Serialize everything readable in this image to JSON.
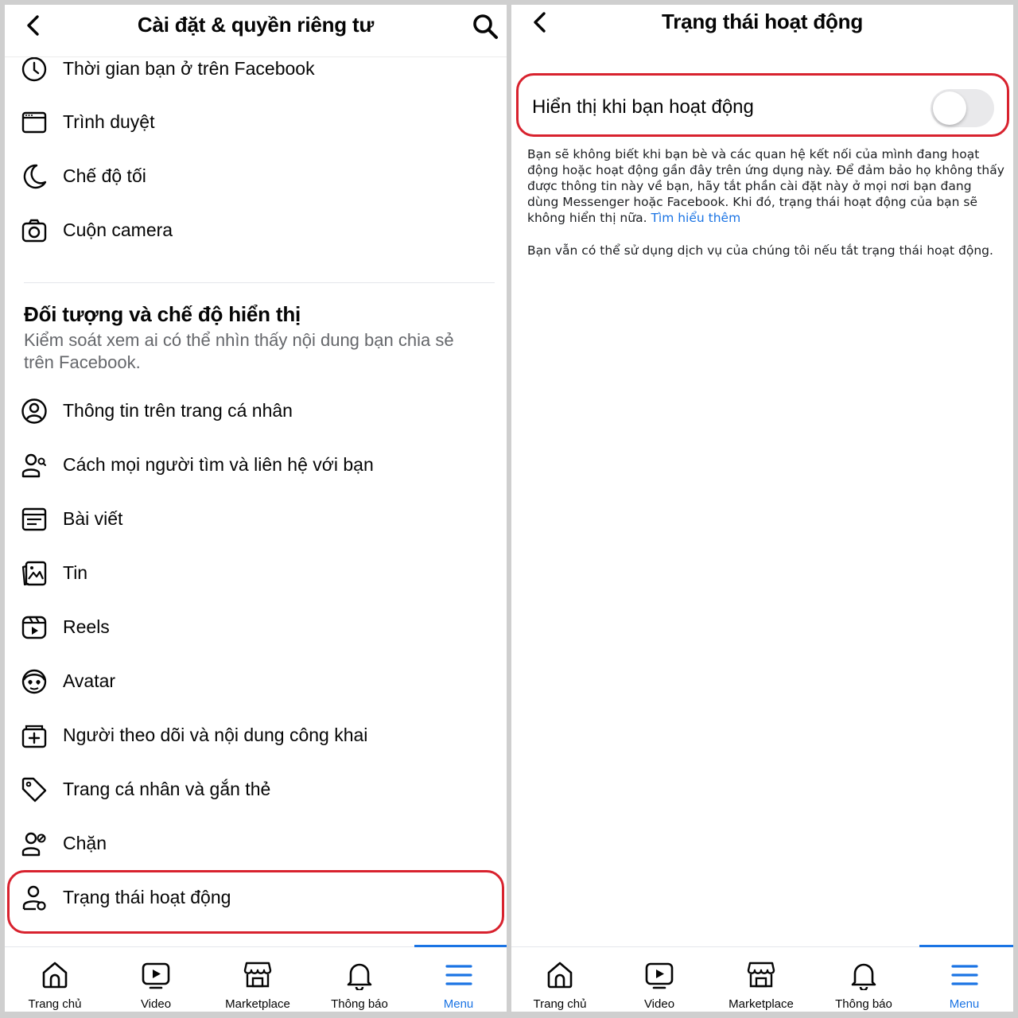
{
  "left": {
    "header_title": "Cài đặt & quyền riêng tư",
    "top_items": [
      {
        "label": "Thời gian bạn ở trên Facebook",
        "icon": "clock-icon"
      },
      {
        "label": "Trình duyệt",
        "icon": "browser-icon"
      },
      {
        "label": "Chế độ tối",
        "icon": "moon-icon"
      },
      {
        "label": "Cuộn camera",
        "icon": "camera-icon"
      }
    ],
    "section": {
      "title": "Đối tượng và chế độ hiển thị",
      "description": "Kiểm soát xem ai có thể nhìn thấy nội dung bạn chia sẻ trên Facebook."
    },
    "items": [
      {
        "label": "Thông tin trên trang cá nhân",
        "icon": "profile-circle-icon"
      },
      {
        "label": "Cách mọi người tìm và liên hệ với bạn",
        "icon": "people-search-icon"
      },
      {
        "label": "Bài viết",
        "icon": "post-icon"
      },
      {
        "label": "Tin",
        "icon": "stories-icon"
      },
      {
        "label": "Reels",
        "icon": "reels-icon"
      },
      {
        "label": "Avatar",
        "icon": "avatar-icon"
      },
      {
        "label": "Người theo dõi và nội dung công khai",
        "icon": "followers-icon"
      },
      {
        "label": "Trang cá nhân và gắn thẻ",
        "icon": "tag-icon"
      },
      {
        "label": "Chặn",
        "icon": "block-user-icon"
      },
      {
        "label": "Trạng thái hoạt động",
        "icon": "active-status-icon"
      }
    ]
  },
  "right": {
    "header_title": "Trạng thái hoạt động",
    "setting_label": "Hiển thị khi bạn hoạt động",
    "toggle_on": false,
    "paragraph1": "Bạn sẽ không biết khi bạn bè và các quan hệ kết nối của mình đang hoạt động hoặc hoạt động gần đây trên ứng dụng này. Để đảm bảo họ không thấy được thông tin này về bạn, hãy tắt phần cài đặt này ở mọi nơi bạn đang dùng Messenger hoặc Facebook. Khi đó, trạng thái hoạt động của bạn sẽ không hiển thị nữa.",
    "learn_more": "Tìm hiểu thêm",
    "paragraph2": "Bạn vẫn có thể sử dụng dịch vụ của chúng tôi nếu tắt trạng thái hoạt động."
  },
  "tabs": [
    {
      "label": "Trang chủ",
      "icon": "home-icon"
    },
    {
      "label": "Video",
      "icon": "video-icon"
    },
    {
      "label": "Marketplace",
      "icon": "marketplace-icon"
    },
    {
      "label": "Thông báo",
      "icon": "bell-icon"
    },
    {
      "label": "Menu",
      "icon": "menu-icon",
      "active": true
    }
  ],
  "colors": {
    "accent": "#1b74e4",
    "highlight": "#d8222e",
    "toggle_off": "#e9e9eb"
  }
}
